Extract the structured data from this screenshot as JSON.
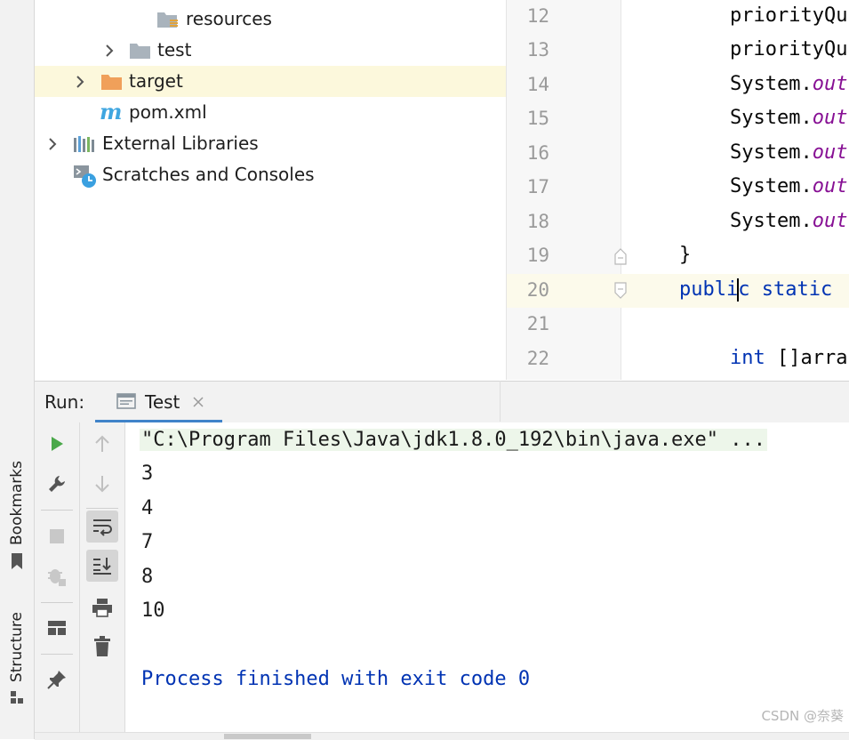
{
  "side_tabs": {
    "bookmarks": "Bookmarks",
    "structure": "Structure"
  },
  "tree": {
    "items": [
      {
        "label": "resources",
        "icon": "resources-folder-icon"
      },
      {
        "label": "test",
        "icon": "folder-icon"
      },
      {
        "label": "target",
        "icon": "excluded-folder-icon"
      },
      {
        "label": "pom.xml",
        "icon": "maven-icon"
      },
      {
        "label": "External Libraries",
        "icon": "libraries-icon"
      },
      {
        "label": "Scratches and Consoles",
        "icon": "scratches-icon"
      }
    ]
  },
  "editor": {
    "lines": [
      {
        "num": "12",
        "indent": "        ",
        "a": "priorityQu",
        "b": ""
      },
      {
        "num": "13",
        "indent": "        ",
        "a": "priorityQu",
        "b": ""
      },
      {
        "num": "14",
        "indent": "        ",
        "a": "System.",
        "b": "out"
      },
      {
        "num": "15",
        "indent": "        ",
        "a": "System.",
        "b": "out"
      },
      {
        "num": "16",
        "indent": "        ",
        "a": "System.",
        "b": "out"
      },
      {
        "num": "17",
        "indent": "        ",
        "a": "System.",
        "b": "out"
      },
      {
        "num": "18",
        "indent": "        ",
        "a": "System.",
        "b": "out"
      },
      {
        "num": "19",
        "text": "}"
      },
      {
        "num": "20",
        "kw1": "publi",
        "kw2": "c static"
      },
      {
        "num": "21",
        "text": ""
      },
      {
        "num": "22",
        "kw": "int",
        "rest": " []arra"
      }
    ]
  },
  "run": {
    "title": "Run:",
    "tab_label": "Test",
    "command": "\"C:\\Program Files\\Java\\jdk1.8.0_192\\bin\\java.exe\" ...",
    "output": [
      "3",
      "4",
      "7",
      "8",
      "10"
    ],
    "exit_message": "Process finished with exit code 0"
  },
  "watermark": "CSDN @奈葵",
  "colors": {
    "selection": "#fcf8dc",
    "keyword": "#0033b3",
    "field": "#871094",
    "run_green": "#4aa84a",
    "tab_underline": "#4083c9",
    "folder_orange": "#f0a05a"
  }
}
